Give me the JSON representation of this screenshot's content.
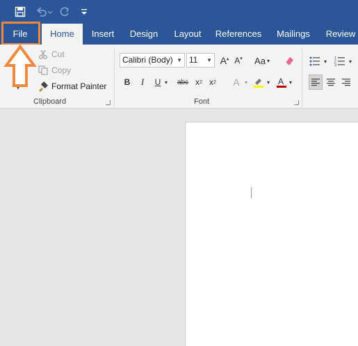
{
  "quick_access": {
    "save_icon": "save-icon",
    "undo_icon": "undo-icon",
    "redo_icon": "redo-icon",
    "customize_icon": "customize-qat-icon"
  },
  "tabs": [
    {
      "label": "File"
    },
    {
      "label": "Home"
    },
    {
      "label": "Insert"
    },
    {
      "label": "Design"
    },
    {
      "label": "Layout"
    },
    {
      "label": "References"
    },
    {
      "label": "Mailings"
    },
    {
      "label": "Review"
    }
  ],
  "clipboard": {
    "cut_label": "Cut",
    "copy_label": "Copy",
    "format_painter_label": "Format Painter",
    "group_label": "Clipboard"
  },
  "font": {
    "font_name": "Calibri (Body)",
    "font_size": "11",
    "group_label": "Font",
    "bold": "B",
    "italic": "I",
    "underline": "U",
    "strikethrough": "abc",
    "subscript": "x",
    "superscript": "x",
    "change_case": "Aa",
    "sub_mark": "2",
    "sup_mark": "2"
  },
  "colors": {
    "title_bar": "#2b579a",
    "highlight": "#f0883e",
    "font_color": "#c00000",
    "highlight_color": "#ffff00"
  }
}
